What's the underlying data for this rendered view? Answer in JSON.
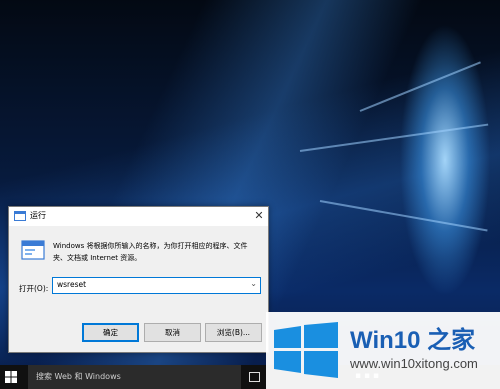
{
  "dialog": {
    "title": "运行",
    "description": "Windows 将根据你所输入的名称，为你打开相应的程序、文件夹、文档或 Internet 资源。",
    "open_label": "打开(O):",
    "input_value": "wsreset",
    "buttons": {
      "ok": "确定",
      "cancel": "取消",
      "browse": "浏览(B)..."
    }
  },
  "taskbar": {
    "search_placeholder": "搜索 Web 和 Windows"
  },
  "watermark": {
    "title": "Win10 之家",
    "url": "www.win10xitong.com"
  },
  "colors": {
    "accent": "#0078d7",
    "wallpaper_blue": "#0a2a66",
    "logo_blue": "#1a8fe0"
  }
}
